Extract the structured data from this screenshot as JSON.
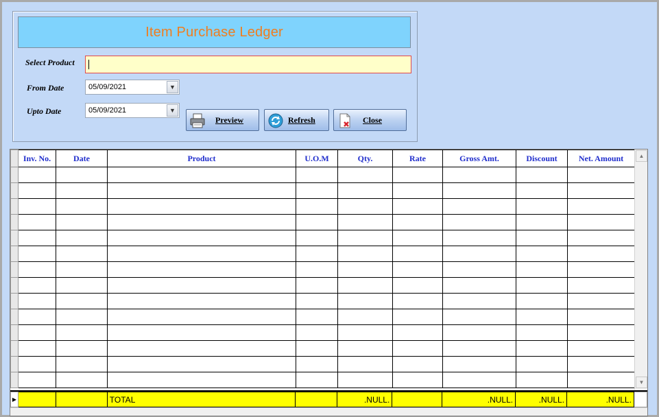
{
  "form": {
    "title": "Item Purchase Ledger",
    "select_product_label": "Select Product",
    "select_product_value": "",
    "from_date_label": "From Date",
    "from_date_value": "05/09/2021",
    "upto_date_label": "Upto Date",
    "upto_date_value": "05/09/2021",
    "preview_label": "Preview",
    "refresh_label": "Refresh",
    "close_label": "Close"
  },
  "grid": {
    "columns": [
      "Inv. No.",
      "Date",
      "Product",
      "U.O.M",
      "Qty.",
      "Rate",
      "Gross Amt.",
      "Discount",
      "Net. Amount"
    ],
    "empty_rows": 14,
    "total": {
      "label": "TOTAL",
      "qty": ".NULL.",
      "gross_amt": ".NULL.",
      "discount": ".NULL.",
      "net_amount": ".NULL."
    }
  },
  "colors": {
    "background": "#c3d9f7",
    "title_bar": "#7fd3fd",
    "title_text": "#f07d1e",
    "header_text": "#1f2dcc",
    "total_row": "#ffff00",
    "product_input_bg": "#ffffc9",
    "product_input_border": "#e0484b"
  }
}
